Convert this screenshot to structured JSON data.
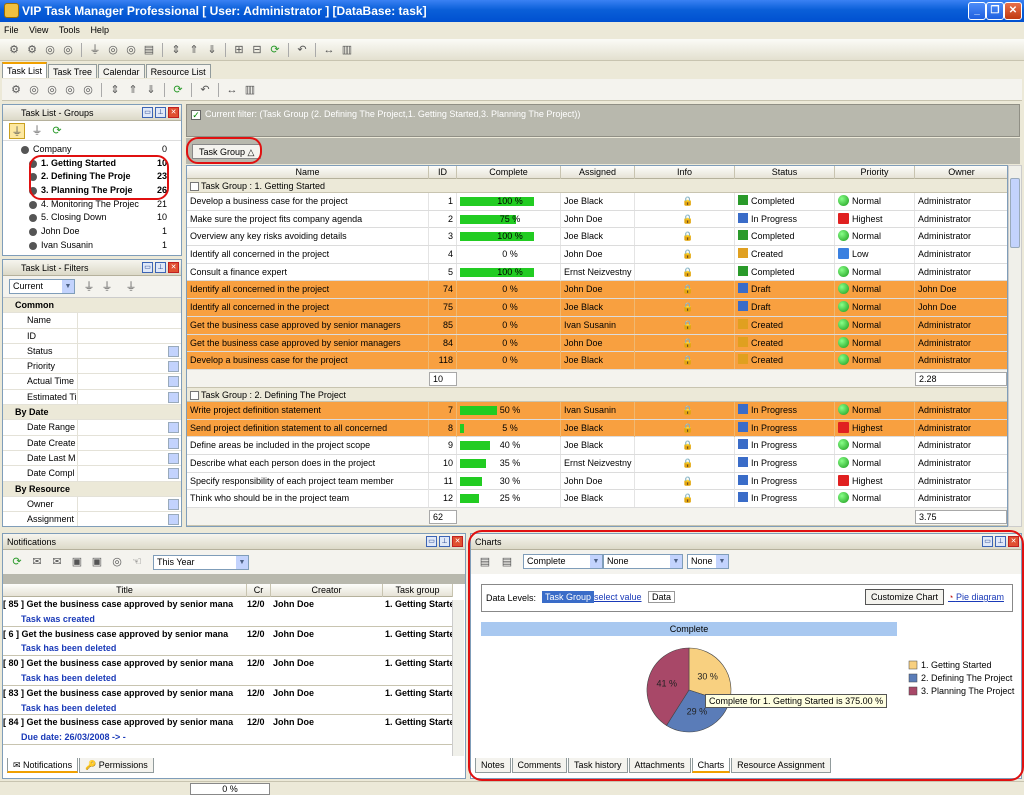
{
  "window": {
    "title": "VIP Task Manager Professional [ User: Administrator ] [DataBase: task]"
  },
  "menu": [
    "File",
    "View",
    "Tools",
    "Help"
  ],
  "main_tabs": [
    "Task List",
    "Task Tree",
    "Calendar",
    "Resource List"
  ],
  "groups_panel": {
    "title": "Task List - Groups",
    "items": [
      {
        "label": "Company",
        "count": "0"
      },
      {
        "label": "1. Getting Started",
        "count": "10"
      },
      {
        "label": "2. Defining The Proje",
        "count": "23"
      },
      {
        "label": "3. Planning The Proje",
        "count": "26"
      },
      {
        "label": "4. Monitoring The Projec",
        "count": "21"
      },
      {
        "label": "5. Closing Down",
        "count": "10"
      },
      {
        "label": "John Doe",
        "count": "1"
      },
      {
        "label": "Ivan Susanin",
        "count": "1"
      }
    ]
  },
  "filters_panel": {
    "title": "Task List - Filters",
    "current": "Current",
    "rows": [
      {
        "label": "Common",
        "section": true
      },
      {
        "label": "Name"
      },
      {
        "label": "ID"
      },
      {
        "label": "Status",
        "dd": true
      },
      {
        "label": "Priority",
        "dd": true
      },
      {
        "label": "Actual Time",
        "dd": true
      },
      {
        "label": "Estimated Ti",
        "dd": true
      },
      {
        "label": "By Date",
        "section": true
      },
      {
        "label": "Date Range",
        "dd": true
      },
      {
        "label": "Date Create",
        "dd": true
      },
      {
        "label": "Date Last M",
        "dd": true
      },
      {
        "label": "Date Compl",
        "dd": true
      },
      {
        "label": "By Resource",
        "section": true
      },
      {
        "label": "Owner",
        "dd": true
      },
      {
        "label": "Assignment",
        "dd": true
      }
    ]
  },
  "filter_bar": "Current filter:  (Task Group  (2. Defining The Project,1. Getting Started,3. Planning The Project))",
  "group_by_chip": "Task Group",
  "columns": [
    "Name",
    "ID",
    "Complete",
    "Assigned",
    "Info",
    "Status",
    "Priority",
    "Owner"
  ],
  "groups": [
    {
      "header": "Task Group : 1. Getting Started",
      "rows": [
        {
          "name": "Develop a business case for the project",
          "id": "1",
          "complete": "100 %",
          "pct": 100,
          "assigned": "Joe Black",
          "status": "Completed",
          "priority": "Normal",
          "owner": "Administrator",
          "orange": false
        },
        {
          "name": "Make sure the project fits company agenda",
          "id": "2",
          "complete": "75 %",
          "pct": 75,
          "assigned": "John Doe",
          "status": "In Progress",
          "priority": "Highest",
          "owner": "Administrator",
          "orange": false
        },
        {
          "name": "Overview any key risks avoiding details",
          "id": "3",
          "complete": "100 %",
          "pct": 100,
          "assigned": "Joe Black",
          "status": "Completed",
          "priority": "Normal",
          "owner": "Administrator",
          "orange": false
        },
        {
          "name": "Identify all concerned in the project",
          "id": "4",
          "complete": "0 %",
          "pct": 0,
          "assigned": "John Doe",
          "status": "Created",
          "priority": "Low",
          "owner": "Administrator",
          "orange": false
        },
        {
          "name": "Consult a finance expert",
          "id": "5",
          "complete": "100 %",
          "pct": 100,
          "assigned": "Ernst Neizvestny",
          "status": "Completed",
          "priority": "Normal",
          "owner": "Administrator",
          "orange": false
        },
        {
          "name": "Identify all concerned in the project",
          "id": "74",
          "complete": "0 %",
          "pct": 0,
          "assigned": "John Doe",
          "status": "Draft",
          "priority": "Normal",
          "owner": "John Doe",
          "orange": true
        },
        {
          "name": "Identify all concerned in the project",
          "id": "75",
          "complete": "0 %",
          "pct": 0,
          "assigned": "Joe Black",
          "status": "Draft",
          "priority": "Normal",
          "owner": "John Doe",
          "orange": true
        },
        {
          "name": "Get the business case approved by senior managers",
          "id": "85",
          "complete": "0 %",
          "pct": 0,
          "assigned": "Ivan Susanin",
          "status": "Created",
          "priority": "Normal",
          "owner": "Administrator",
          "orange": true
        },
        {
          "name": "Get the business case approved by senior managers",
          "id": "84",
          "complete": "0 %",
          "pct": 0,
          "assigned": "John Doe",
          "status": "Created",
          "priority": "Normal",
          "owner": "Administrator",
          "orange": true
        },
        {
          "name": "Develop a business case for the project",
          "id": "118",
          "complete": "0 %",
          "pct": 0,
          "assigned": "Joe Black",
          "status": "Created",
          "priority": "Normal",
          "owner": "Administrator",
          "orange": true
        }
      ],
      "sum_id": "10",
      "sum_owner": "2.28"
    },
    {
      "header": "Task Group : 2. Defining The Project",
      "rows": [
        {
          "name": "Write project definition statement",
          "id": "7",
          "complete": "50 %",
          "pct": 50,
          "assigned": "Ivan Susanin",
          "status": "In Progress",
          "priority": "Normal",
          "owner": "Administrator",
          "orange": true
        },
        {
          "name": "Send project definition statement to all concerned",
          "id": "8",
          "complete": "5 %",
          "pct": 5,
          "assigned": "Joe Black",
          "status": "In Progress",
          "priority": "Highest",
          "owner": "Administrator",
          "orange": true
        },
        {
          "name": "Define areas be included in the project scope",
          "id": "9",
          "complete": "40 %",
          "pct": 40,
          "assigned": "Joe Black",
          "status": "In Progress",
          "priority": "Normal",
          "owner": "Administrator",
          "orange": false
        },
        {
          "name": "Describe what each person does in the project",
          "id": "10",
          "complete": "35 %",
          "pct": 35,
          "assigned": "Ernst Neizvestny",
          "status": "In Progress",
          "priority": "Normal",
          "owner": "Administrator",
          "orange": false
        },
        {
          "name": "Specify responsibility of each project team member",
          "id": "11",
          "complete": "30 %",
          "pct": 30,
          "assigned": "John Doe",
          "status": "In Progress",
          "priority": "Highest",
          "owner": "Administrator",
          "orange": false
        },
        {
          "name": "Think who should be in the project team",
          "id": "12",
          "complete": "25 %",
          "pct": 25,
          "assigned": "Joe Black",
          "status": "In Progress",
          "priority": "Normal",
          "owner": "Administrator",
          "orange": false
        }
      ],
      "sum_id": "62",
      "sum_owner": "3.75"
    }
  ],
  "notifications": {
    "title": "Notifications",
    "period": "This Year",
    "columns": [
      "Title",
      "Cr",
      "Creator",
      "Task group"
    ],
    "items": [
      {
        "title": "[ 85 ] Get the business case approved by senior mana",
        "date": "12/0",
        "creator": "John Doe",
        "group": "1. Getting Starte",
        "sub": "Task was created"
      },
      {
        "title": "[ 6 ] Get the business case approved by senior mana",
        "date": "12/0",
        "creator": "John Doe",
        "group": "1. Getting Starte",
        "sub": "Task has been deleted"
      },
      {
        "title": "[ 80 ] Get the business case approved by senior mana",
        "date": "12/0",
        "creator": "John Doe",
        "group": "1. Getting Starte",
        "sub": "Task has been deleted"
      },
      {
        "title": "[ 83 ] Get the business case approved by senior mana",
        "date": "12/0",
        "creator": "John Doe",
        "group": "1. Getting Starte",
        "sub": "Task has been deleted"
      },
      {
        "title": "[ 84 ] Get the business case approved by senior mana",
        "date": "12/0",
        "creator": "John Doe",
        "group": "1. Getting Starte",
        "sub": "Due date: 26/03/2008 -> -"
      }
    ],
    "tabs": [
      "Notifications",
      "Permissions"
    ]
  },
  "charts": {
    "title": "Charts",
    "combo1": "Complete",
    "combo2": "None",
    "combo3": "None",
    "data_levels_label": "Data Levels:",
    "level_task_group": "Task Group",
    "level_select": "select value",
    "level_data": "Data",
    "customize": "Customize Chart",
    "pie_link": "Pie diagram",
    "chart_header": "Complete",
    "tooltip": "Complete for 1. Getting Started is 375.00 %",
    "tabs": [
      "Notes",
      "Comments",
      "Task history",
      "Attachments",
      "Charts",
      "Resource Assignment"
    ]
  },
  "chart_data": {
    "type": "pie",
    "title": "Complete",
    "categories": [
      "1. Getting Started",
      "2. Defining The Project",
      "3. Planning The Project"
    ],
    "values": [
      30,
      29,
      41
    ],
    "labels": [
      "30 %",
      "29 %",
      "41 %"
    ],
    "colors": [
      "#f8d080",
      "#5a7cb8",
      "#a84868"
    ],
    "legend_position": "right"
  },
  "statusbar": {
    "progress": "0 %"
  }
}
